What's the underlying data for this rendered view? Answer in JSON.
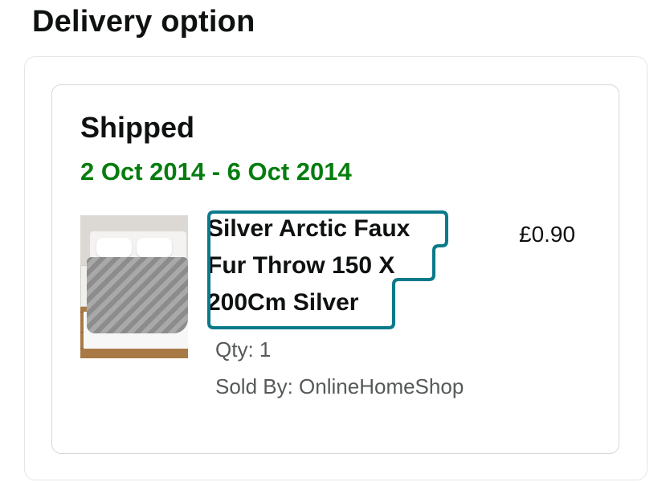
{
  "section": {
    "title": "Delivery option"
  },
  "shipment": {
    "status": "Shipped",
    "delivery_dates": "2 Oct 2014 - 6 Oct 2014",
    "date_color": "#067d0f"
  },
  "item": {
    "image_icon": "product-thumbnail",
    "title": "Silver Arctic Faux Fur Throw 150 X 200Cm Silver",
    "price": "£0.90",
    "qty": "Qty: 1",
    "sold_by": "Sold By: OnlineHomeShop"
  },
  "focus_color": "#0a7a8a"
}
